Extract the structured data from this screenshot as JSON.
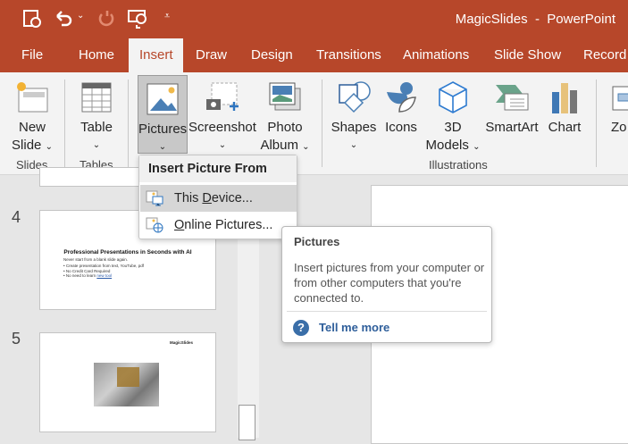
{
  "title_bar": {
    "title": "MagicSlides  -  PowerPoint",
    "qat": [
      "autosave-icon",
      "undo-icon",
      "redo-icon",
      "present-icon",
      "customize-icon"
    ]
  },
  "tabs": [
    "File",
    "Home",
    "Insert",
    "Draw",
    "Design",
    "Transitions",
    "Animations",
    "Slide Show",
    "Record"
  ],
  "ribbon": {
    "groups": [
      {
        "label": "Slides"
      },
      {
        "label": "Tables"
      },
      {
        "label": "Illustrations"
      }
    ],
    "buttons": {
      "new_slide": [
        "New",
        "Slide"
      ],
      "table": "Table",
      "pictures": "Pictures",
      "screenshot": "Screenshot",
      "photo_album": [
        "Photo",
        "Album"
      ],
      "shapes": "Shapes",
      "icons": "Icons",
      "models": [
        "3D",
        "Models"
      ],
      "smartart": "SmartArt",
      "chart": "Chart",
      "zoom": "Zo"
    }
  },
  "menu": {
    "header": "Insert Picture From",
    "items": [
      {
        "pre": "This ",
        "key": "D",
        "post": "evice..."
      },
      {
        "pre": "",
        "key": "O",
        "post": "nline Pictures..."
      }
    ]
  },
  "tooltip": {
    "title": "Pictures",
    "body": "Insert pictures from your computer or from other computers that you're connected to.",
    "link": "Tell me more"
  },
  "slides": [
    {
      "number": "4",
      "title": "Professional Presentations in Seconds with AI",
      "subtitle": "Never start from a blank slide again.",
      "bullets": [
        "• Create presentation from text, YouTube, pdf",
        "• No Credit Card Required",
        "• No need to learn "
      ],
      "link": "new tool"
    },
    {
      "number": "5",
      "logo": "MagicSlides"
    }
  ]
}
